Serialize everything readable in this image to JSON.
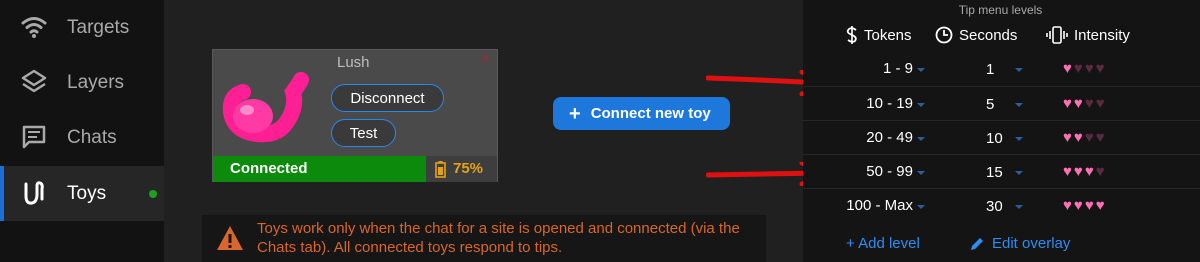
{
  "sidebar": {
    "items": [
      {
        "label": "Targets",
        "icon": "wifi-icon",
        "active": false
      },
      {
        "label": "Layers",
        "icon": "layers-icon",
        "active": false
      },
      {
        "label": "Chats",
        "icon": "chat-icon",
        "active": false
      },
      {
        "label": "Toys",
        "icon": "toy-icon",
        "active": true,
        "status": "online"
      }
    ]
  },
  "toy": {
    "name": "Lush",
    "disconnect_label": "Disconnect",
    "test_label": "Test",
    "status": "Connected",
    "battery": "75%",
    "battery_fraction": 0.75
  },
  "connect_new_toy_label": "Connect new toy",
  "warning_text": "Toys work only when the chat for a site is opened and connected (via the Chats tab). All connected toys respond to tips.",
  "tip_menu": {
    "title": "Tip menu levels",
    "columns": {
      "tokens": "Tokens",
      "seconds": "Seconds",
      "intensity": "Intensity"
    },
    "rows": [
      {
        "tokens": "1 - 9",
        "seconds": "1",
        "intensity": 1
      },
      {
        "tokens": "10 - 19",
        "seconds": "5",
        "intensity": 2
      },
      {
        "tokens": "20 - 49",
        "seconds": "10",
        "intensity": 2
      },
      {
        "tokens": "50 - 99",
        "seconds": "15",
        "intensity": 3
      },
      {
        "tokens": "100 - Max",
        "seconds": "30",
        "intensity": 4
      }
    ],
    "max_intensity": 4,
    "add_level_label": "+ Add level",
    "edit_overlay_label": "Edit overlay"
  },
  "colors": {
    "accent": "#1e78dc",
    "connected": "#0b8a0b",
    "battery": "#e3a21a",
    "warning": "#d9662b",
    "heart_on": "#ff6fb4",
    "heart_off": "#5a2a3e",
    "arrow": "#e01010"
  }
}
